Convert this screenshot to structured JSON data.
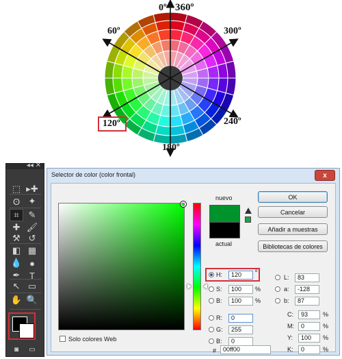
{
  "wheel": {
    "angles": [
      "0º",
      "360º",
      "60º",
      "300º",
      "120º",
      "240º",
      "180º"
    ]
  },
  "tools": {
    "icons": [
      "marquee-icon",
      "move-icon",
      "lasso-icon",
      "magic-wand-icon",
      "crop-icon",
      "eyedropper-icon",
      "healing-icon",
      "brush-icon",
      "stamp-icon",
      "history-brush-icon",
      "eraser-icon",
      "gradient-icon",
      "blur-icon",
      "dodge-icon",
      "pen-icon",
      "type-icon",
      "path-select-icon",
      "shape-icon",
      "hand-icon",
      "zoom-icon"
    ]
  },
  "dialog": {
    "title": "Selector de color (color frontal)",
    "close_label": "x",
    "new_label": "nuevo",
    "current_label": "actual",
    "new_color": "#00922d",
    "current_color": "#000000",
    "buttons": {
      "ok": "OK",
      "cancel": "Cancelar",
      "add_swatch": "Añadir a muestras",
      "libraries": "Bibliotecas de colores"
    },
    "hsb": {
      "h_label": "H:",
      "h_value": "120",
      "h_unit": "º",
      "s_label": "S:",
      "s_value": "100",
      "s_unit": "%",
      "b_label": "B:",
      "b_value": "100",
      "b_unit": "%"
    },
    "rgb": {
      "r_label": "R:",
      "r_value": "0",
      "g_label": "G:",
      "g_value": "255",
      "b_label": "B:",
      "b_value": "0"
    },
    "lab": {
      "l_label": "L:",
      "l_value": "83",
      "a_label": "a:",
      "a_value": "-128",
      "b_label": "b:",
      "b_value": "87"
    },
    "cmyk": {
      "c_label": "C:",
      "c_value": "93",
      "c_unit": "%",
      "m_label": "M:",
      "m_value": "0",
      "m_unit": "%",
      "y_label": "Y:",
      "y_value": "100",
      "y_unit": "%",
      "k_label": "K:",
      "k_value": "0",
      "k_unit": "%"
    },
    "hex_label": "#",
    "hex_value": "00ff00",
    "web_only_label": "Solo colores Web"
  }
}
